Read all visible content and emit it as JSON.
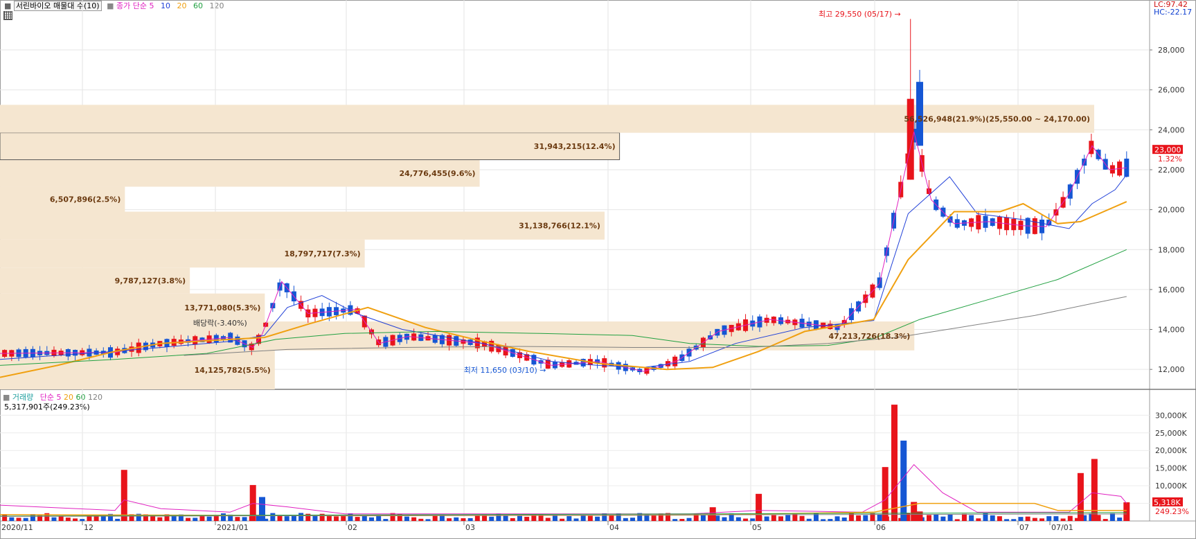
{
  "header": {
    "title": "서린바이오 매물대 수(10)",
    "ma_label": "종가 단순",
    "ma_periods": [
      "5",
      "10",
      "20",
      "60",
      "120"
    ],
    "lc": "LC:97.42",
    "hc": "HC:-22.17"
  },
  "volume_header": {
    "label": "거래량",
    "ma_label": "단순",
    "ma_periods": [
      "5",
      "20",
      "60",
      "120"
    ],
    "value_text": "5,317,901주(249.23%)"
  },
  "colors": {
    "up": "#e8141b",
    "down": "#1556d4",
    "ma5": "#e020c0",
    "ma10": "#2040d8",
    "ma20": "#f0a010",
    "ma60": "#20a040",
    "ma120": "#808080",
    "band": "#f5e6d0"
  },
  "chart_data": [
    {
      "type": "candlestick",
      "title": "서린바이오 매물대 수(10)",
      "ylim": [
        11000,
        30500
      ],
      "y_ticks": [
        12000,
        14000,
        16000,
        18000,
        20000,
        22000,
        24000,
        26000,
        28000
      ],
      "y_tick_labels": [
        "12,000",
        "14,000",
        "16,000",
        "18,000",
        "20,000",
        "22,000",
        "24,000",
        "26,000",
        "28,000"
      ],
      "x_labels": [
        "2020/11",
        "12",
        "2021/01",
        "02",
        "03",
        "04",
        "05",
        "06",
        "07",
        "07/01"
      ],
      "current_price": "23,000",
      "current_change": "1.32%",
      "annotations": [
        {
          "text": "최고 29,550 (05/17)",
          "value": 29550
        },
        {
          "text": "최저 11,650 (03/10)",
          "value": 11650
        },
        {
          "text": "배당락(-3.40%)"
        }
      ],
      "volume_profile": [
        {
          "text": "14,125,782(5.5%)",
          "from": 11000,
          "to": 12950,
          "pct": 5.5
        },
        {
          "text": "47,213,726(18.3%)",
          "from": 12950,
          "to": 14400,
          "pct": 18.3
        },
        {
          "text": "13,771,080(5.3%)",
          "from": 14400,
          "to": 15800,
          "pct": 5.3
        },
        {
          "text": "9,787,127(3.8%)",
          "from": 15800,
          "to": 17100,
          "pct": 3.8
        },
        {
          "text": "18,797,717(7.3%)",
          "from": 17100,
          "to": 18500,
          "pct": 7.3
        },
        {
          "text": "31,138,766(12.1%)",
          "from": 18500,
          "to": 19900,
          "pct": 12.1
        },
        {
          "text": "6,507,896(2.5%)",
          "from": 19900,
          "to": 21150,
          "pct": 2.5
        },
        {
          "text": "24,776,455(9.6%)",
          "from": 21150,
          "to": 22500,
          "pct": 9.6
        },
        {
          "text": "31,943,215(12.4%)",
          "from": 22500,
          "to": 23850,
          "pct": 12.4,
          "current": true
        },
        {
          "text": "56,526,948(21.9%)(25,550.00 ~ 24,170.00)",
          "from": 23850,
          "to": 25250,
          "pct": 21.9
        }
      ],
      "series": [
        {
          "name": "5",
          "anchors": [
            [
              0,
              12800
            ],
            [
              0.1,
              12850
            ],
            [
              0.14,
              13300
            ],
            [
              0.2,
              13600
            ],
            [
              0.22,
              13100
            ],
            [
              0.228,
              13750
            ],
            [
              0.245,
              16400
            ],
            [
              0.268,
              14800
            ],
            [
              0.31,
              15000
            ],
            [
              0.33,
              13300
            ],
            [
              0.355,
              13650
            ],
            [
              0.42,
              13300
            ],
            [
              0.48,
              12200
            ],
            [
              0.52,
              12400
            ],
            [
              0.56,
              11900
            ],
            [
              0.59,
              12450
            ],
            [
              0.625,
              13900
            ],
            [
              0.67,
              14500
            ],
            [
              0.73,
              14100
            ],
            [
              0.765,
              16300
            ],
            [
              0.795,
              23900
            ],
            [
              0.81,
              20500
            ],
            [
              0.83,
              19300
            ],
            [
              0.86,
              19400
            ],
            [
              0.89,
              19200
            ],
            [
              0.91,
              19150
            ],
            [
              0.93,
              20800
            ],
            [
              0.95,
              23200
            ],
            [
              0.965,
              22000
            ],
            [
              0.98,
              22100
            ]
          ]
        },
        {
          "name": "10",
          "anchors": [
            [
              0,
              12500
            ],
            [
              0.1,
              12900
            ],
            [
              0.14,
              13100
            ],
            [
              0.2,
              13400
            ],
            [
              0.23,
              13700
            ],
            [
              0.25,
              15100
            ],
            [
              0.28,
              15700
            ],
            [
              0.31,
              14800
            ],
            [
              0.35,
              14000
            ],
            [
              0.42,
              13300
            ],
            [
              0.48,
              12400
            ],
            [
              0.52,
              12200
            ],
            [
              0.56,
              12100
            ],
            [
              0.6,
              12400
            ],
            [
              0.64,
              13300
            ],
            [
              0.7,
              14100
            ],
            [
              0.76,
              14450
            ],
            [
              0.79,
              19800
            ],
            [
              0.826,
              21650
            ],
            [
              0.85,
              19800
            ],
            [
              0.89,
              19500
            ],
            [
              0.93,
              19050
            ],
            [
              0.95,
              20300
            ],
            [
              0.97,
              21000
            ],
            [
              0.98,
              21750
            ]
          ]
        },
        {
          "name": "20",
          "anchors": [
            [
              0,
              11600
            ],
            [
              0.05,
              12200
            ],
            [
              0.1,
              12900
            ],
            [
              0.14,
              13300
            ],
            [
              0.2,
              13500
            ],
            [
              0.23,
              13600
            ],
            [
              0.27,
              14300
            ],
            [
              0.32,
              15100
            ],
            [
              0.37,
              14100
            ],
            [
              0.42,
              13400
            ],
            [
              0.46,
              12900
            ],
            [
              0.52,
              12300
            ],
            [
              0.58,
              12000
            ],
            [
              0.62,
              12100
            ],
            [
              0.66,
              12900
            ],
            [
              0.7,
              13900
            ],
            [
              0.76,
              14500
            ],
            [
              0.79,
              17500
            ],
            [
              0.83,
              19900
            ],
            [
              0.87,
              19900
            ],
            [
              0.89,
              20300
            ],
            [
              0.92,
              19300
            ],
            [
              0.94,
              19400
            ],
            [
              0.96,
              19900
            ],
            [
              0.98,
              20400
            ]
          ]
        },
        {
          "name": "60",
          "anchors": [
            [
              0,
              12200
            ],
            [
              0.1,
              12500
            ],
            [
              0.18,
              12800
            ],
            [
              0.24,
              13500
            ],
            [
              0.3,
              13800
            ],
            [
              0.38,
              13900
            ],
            [
              0.47,
              13800
            ],
            [
              0.55,
              13700
            ],
            [
              0.6,
              13300
            ],
            [
              0.66,
              13150
            ],
            [
              0.72,
              13200
            ],
            [
              0.76,
              13550
            ],
            [
              0.8,
              14500
            ],
            [
              0.86,
              15500
            ],
            [
              0.92,
              16500
            ],
            [
              0.98,
              18000
            ]
          ]
        },
        {
          "name": "120",
          "anchors": [
            [
              0.16,
              12700
            ],
            [
              0.25,
              13000
            ],
            [
              0.35,
              13100
            ],
            [
              0.45,
              13150
            ],
            [
              0.55,
              13100
            ],
            [
              0.65,
              13100
            ],
            [
              0.72,
              13300
            ],
            [
              0.78,
              13600
            ],
            [
              0.84,
              14150
            ],
            [
              0.9,
              14700
            ],
            [
              0.95,
              15300
            ],
            [
              0.98,
              15650
            ]
          ]
        }
      ]
    },
    {
      "type": "bar",
      "title": "거래량",
      "ylim": [
        0,
        34000
      ],
      "y_ticks": [
        5000,
        10000,
        15000,
        20000,
        25000,
        30000
      ],
      "y_tick_labels": [
        "5,000K",
        "10,000K",
        "15,000K",
        "20,000K",
        "25,000K",
        "30,000K"
      ],
      "current_volume": "5,318K",
      "current_ratio": "249.23%",
      "spikes": [
        [
          0.108,
          14500
        ],
        [
          0.22,
          10200
        ],
        [
          0.228,
          6800
        ],
        [
          0.62,
          3900
        ],
        [
          0.66,
          7700
        ],
        [
          0.77,
          15300
        ],
        [
          0.778,
          33000
        ],
        [
          0.786,
          22800
        ],
        [
          0.795,
          5400
        ],
        [
          0.8,
          2700
        ],
        [
          0.94,
          13600
        ],
        [
          0.952,
          17600
        ],
        [
          0.98,
          5300
        ]
      ]
    }
  ]
}
